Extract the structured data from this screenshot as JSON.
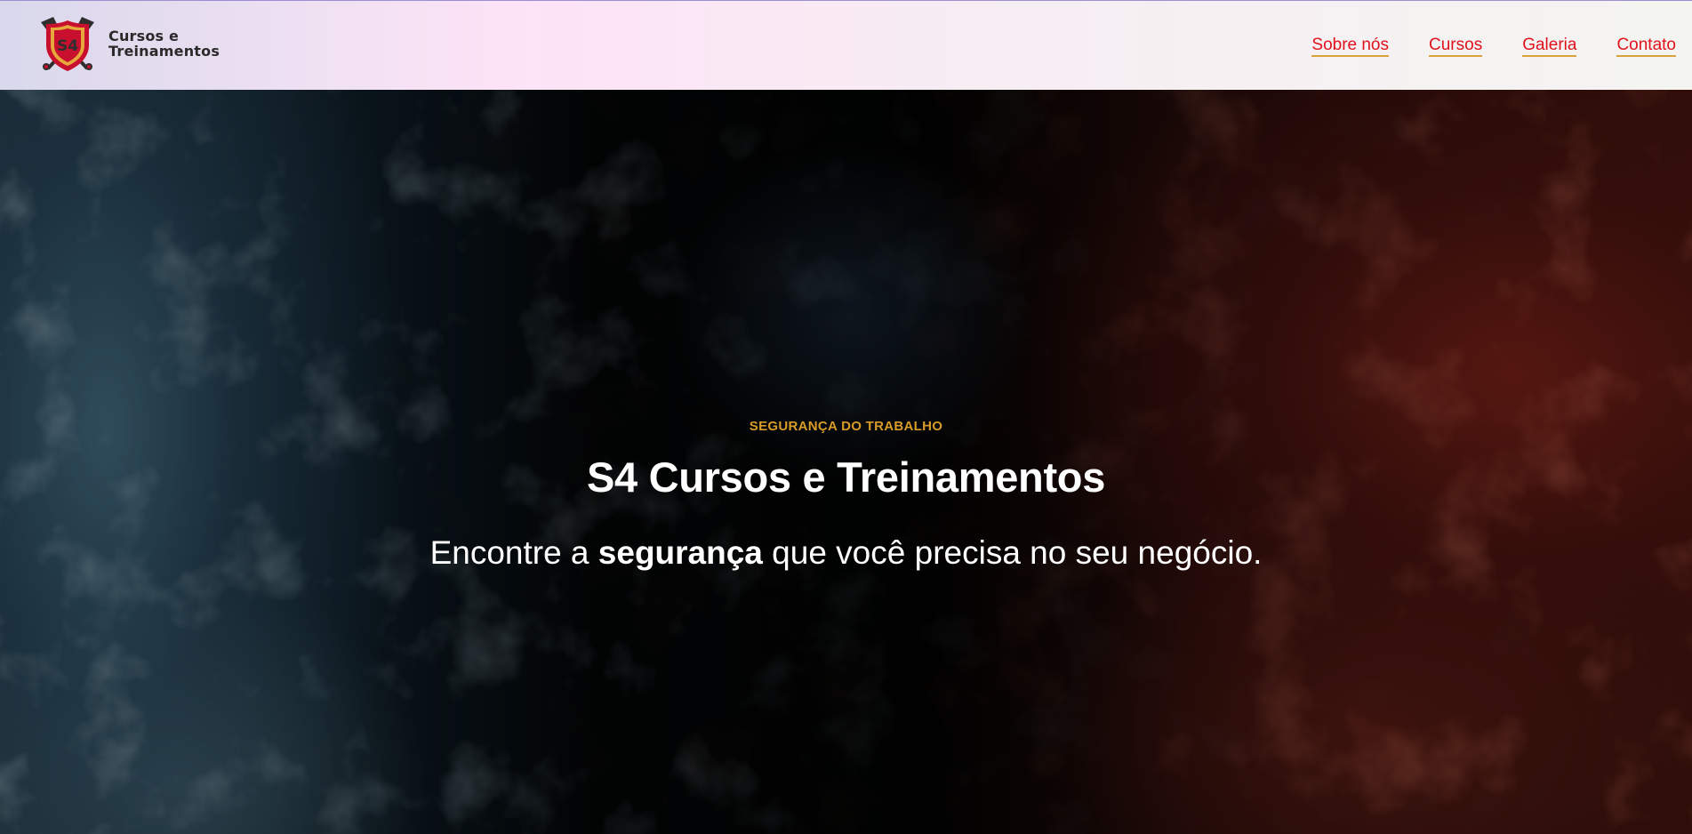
{
  "header": {
    "logo": {
      "badge_text": "S4",
      "line1": "Cursos e",
      "line2": "Treinamentos"
    },
    "nav": [
      {
        "label": "Sobre nós"
      },
      {
        "label": "Cursos"
      },
      {
        "label": "Galeria"
      },
      {
        "label": "Contato"
      }
    ]
  },
  "hero": {
    "eyebrow": "SEGURANÇA DO TRABALHO",
    "title": "S4 Cursos e Treinamentos",
    "subtitle": {
      "before": "Encontre a ",
      "emphasis": "segurança",
      "after": " que você precisa no seu negócio."
    },
    "background": "abstract-fluid-art-image"
  },
  "colors": {
    "nav_link": "#e0131c",
    "nav_underline": "#d9a23a",
    "eyebrow": "#d89b28",
    "hero_text": "#ffffff",
    "logo_red": "#c8102e",
    "logo_gold": "#e6a83a",
    "logo_dark": "#2f2f2f"
  }
}
